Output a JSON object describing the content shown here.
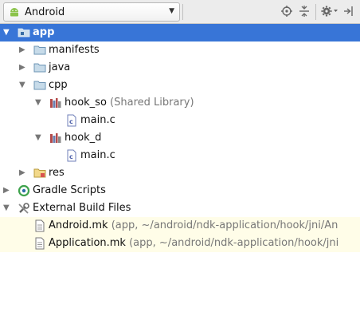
{
  "toolbar": {
    "view_mode": "Android",
    "icons": [
      "android-icon",
      "caret-down-icon",
      "locate-target-icon",
      "collapse-all-icon",
      "settings-gear-icon",
      "hide-panel-icon"
    ]
  },
  "tree": {
    "app": "app",
    "manifests": "manifests",
    "java": "java",
    "cpp": "cpp",
    "hook_so": "hook_so",
    "hook_so_hint": "(Shared Library)",
    "hook_so_main": "main.c",
    "hook_d": "hook_d",
    "hook_d_main": "main.c",
    "res": "res",
    "gradle_scripts": "Gradle Scripts",
    "external_build_files": "External Build Files",
    "android_mk": "Android.mk",
    "android_mk_hint": "(app, ~/android/ndk-application/hook/jni/An",
    "application_mk": "Application.mk",
    "application_mk_hint": "(app, ~/android/ndk-application/hook/jni"
  },
  "colors": {
    "selection": "#3875d7",
    "folder": "#7fa9c9",
    "external_row_bg": "#fffde8"
  }
}
